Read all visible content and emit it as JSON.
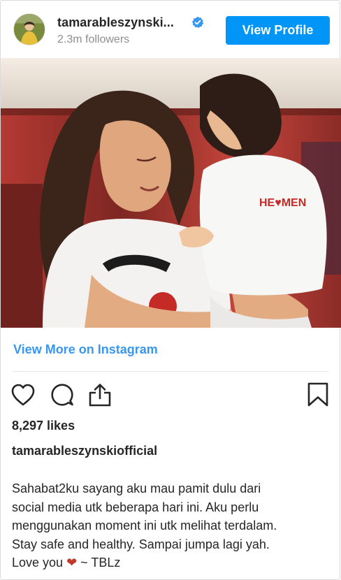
{
  "header": {
    "username": "tamarableszynski...",
    "followers": "2.3m followers",
    "view_profile_label": "View Profile"
  },
  "photo": {
    "alt": "Woman hugging a child, both wearing white shirts"
  },
  "view_more_label": "View More on Instagram",
  "actions": {
    "like_icon": "heart-outline-icon",
    "comment_icon": "comment-icon",
    "share_icon": "share-upload-icon",
    "save_icon": "bookmark-icon"
  },
  "likes_label": "8,297 likes",
  "owner": "tamarableszynskiofficial",
  "caption": {
    "text": "Sahabat2ku sayang aku mau pamit dulu dari\nsocial media utk beberapa hari ini. Aku perlu\nmenggunakan moment ini utk melihat terdalam.\nStay safe and healthy. Sampai jumpa lagi yah.\nLove you ",
    "heart": "❤",
    "signoff": " ~ TBLz"
  },
  "colors": {
    "accent": "#0095f6",
    "link": "#3897f0",
    "muted": "#8e8e8e",
    "text": "#262626",
    "verified": "#3897f0",
    "heart": "#c0392b"
  }
}
